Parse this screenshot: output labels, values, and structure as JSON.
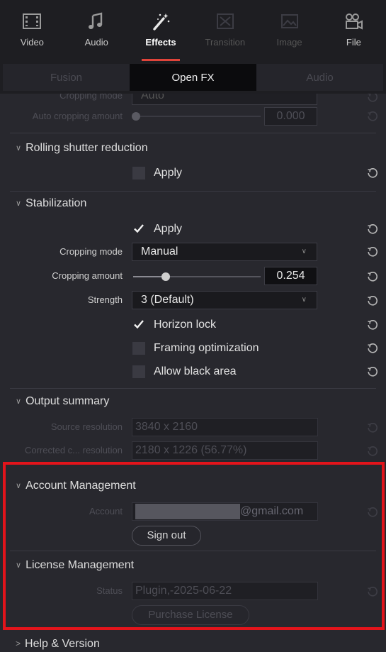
{
  "toolbar": [
    {
      "label": "Video",
      "icon": "film-icon",
      "state": "normal"
    },
    {
      "label": "Audio",
      "icon": "music-note-icon",
      "state": "normal"
    },
    {
      "label": "Effects",
      "icon": "magic-wand-icon",
      "state": "active"
    },
    {
      "label": "Transition",
      "icon": "transition-icon",
      "state": "disabled"
    },
    {
      "label": "Image",
      "icon": "image-icon",
      "state": "disabled"
    },
    {
      "label": "File",
      "icon": "projector-icon",
      "state": "normal"
    }
  ],
  "subtabs": [
    {
      "label": "Fusion",
      "active": false
    },
    {
      "label": "Open FX",
      "active": true
    },
    {
      "label": "Audio",
      "active": false
    }
  ],
  "top_partial": {
    "cropping_mode_label": "Cropping mode",
    "cropping_mode_value": "Auto",
    "auto_cropping_label": "Auto cropping amount",
    "auto_cropping_value": "0.000"
  },
  "rolling_shutter": {
    "title": "Rolling shutter reduction",
    "apply_label": "Apply",
    "apply_checked": false
  },
  "stabilization": {
    "title": "Stabilization",
    "apply_label": "Apply",
    "apply_checked": true,
    "cropping_mode_label": "Cropping mode",
    "cropping_mode_value": "Manual",
    "cropping_amount_label": "Cropping amount",
    "cropping_amount_value": "0.254",
    "cropping_amount_fraction": 0.254,
    "strength_label": "Strength",
    "strength_value": "3 (Default)",
    "horizon_lock_label": "Horizon lock",
    "horizon_lock_checked": true,
    "framing_label": "Framing optimization",
    "framing_checked": false,
    "black_area_label": "Allow black area",
    "black_area_checked": false
  },
  "output_summary": {
    "title": "Output summary",
    "source_label": "Source resolution",
    "source_value": "3840 x 2160",
    "corrected_label": "Corrected c... resolution",
    "corrected_value": "2180 x 1226 (56.77%)"
  },
  "account_management": {
    "title": "Account Management",
    "account_label": "Account",
    "account_suffix": "@gmail.com",
    "sign_out_label": "Sign out"
  },
  "license_management": {
    "title": "License Management",
    "status_label": "Status",
    "status_value": "Plugin,-2025-06-22",
    "purchase_label": "Purchase License"
  },
  "help": {
    "title": "Help & Version"
  },
  "colors": {
    "accent_underline": "#e0443a",
    "highlight_box": "#e3141b"
  }
}
